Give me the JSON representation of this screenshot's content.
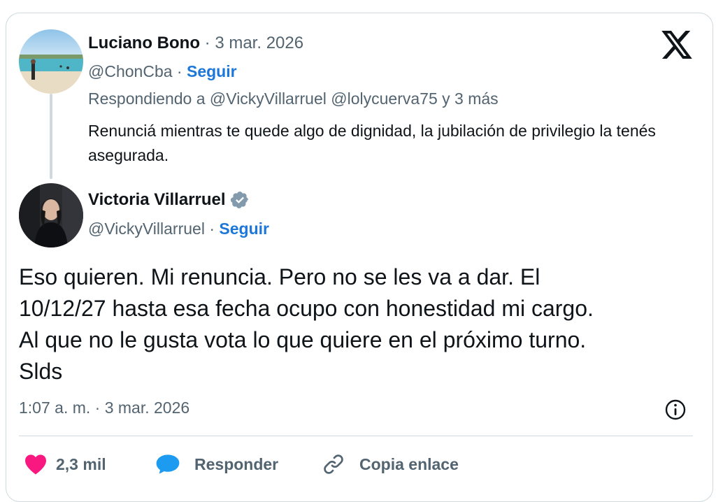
{
  "colors": {
    "follow": "#1d77d8",
    "heart": "#f91880",
    "reply_bubble": "#1d9bf0",
    "verified": "#829aab",
    "muted": "#536471"
  },
  "reply_tweet": {
    "author_name": "Luciano Bono",
    "separator": "·",
    "date": "3 mar. 2026",
    "handle": "@ChonCba",
    "follow_separator": "·",
    "follow_label": "Seguir",
    "replying_prefix": "Respondiendo a",
    "replying_to": "@VickyVillarruel @lolycuerva75",
    "replying_suffix": "y 3 más",
    "text": "Renunciá mientras te quede algo de dignidad, la jubilación de privilegio la tenés asegurada."
  },
  "main_tweet": {
    "author_name": "Victoria Villarruel",
    "verified_icon": "verified-badge-icon",
    "handle": "@VickyVillarruel",
    "follow_separator": "·",
    "follow_label": "Seguir",
    "text_lines": [
      "Eso quieren. Mi renuncia. Pero no se les va a dar. El",
      "10/12/27 hasta esa fecha ocupo con honestidad mi cargo.",
      "Al que no le gusta vota lo que quiere en el próximo turno.",
      "Slds"
    ],
    "timestamp": "1:07 a. m. · 3 mar. 2026"
  },
  "actions": {
    "like_count": "2,3 mil",
    "reply_label": "Responder",
    "copy_label": "Copia enlace"
  },
  "icons": {
    "brand": "x-logo-icon",
    "info": "info-icon",
    "like": "heart-icon",
    "reply": "chat-bubble-icon",
    "copy": "link-icon"
  }
}
